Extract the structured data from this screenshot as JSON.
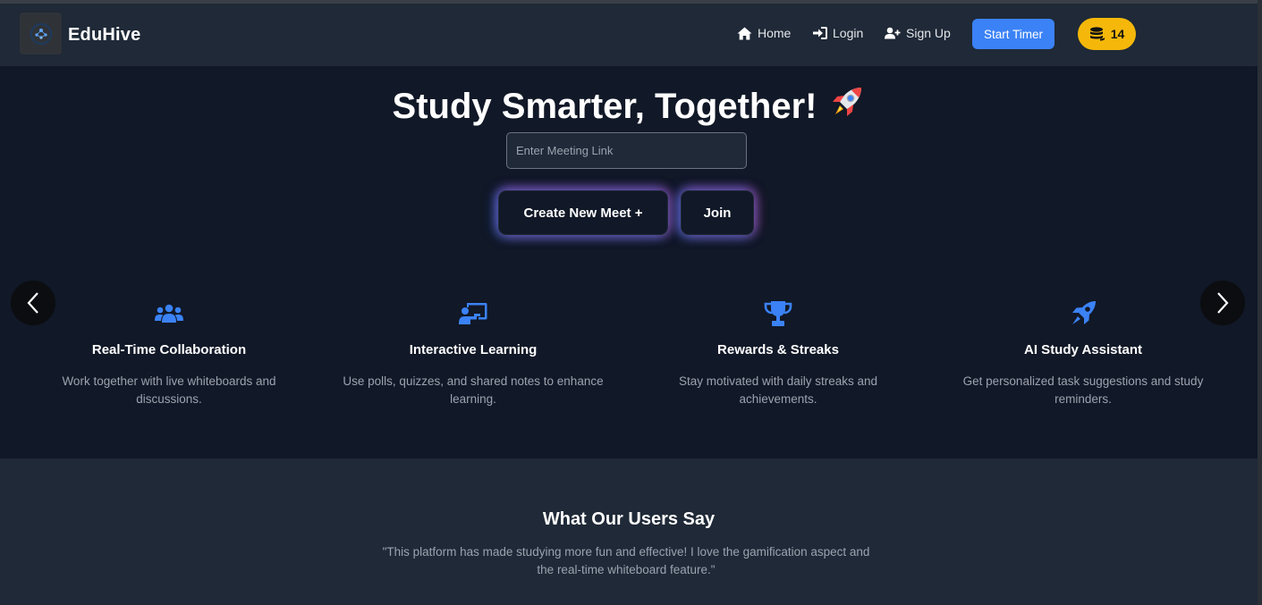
{
  "app": {
    "name": "EduHive"
  },
  "nav": {
    "home": "Home",
    "login": "Login",
    "signup": "Sign Up",
    "start_timer": "Start Timer",
    "coins": "14"
  },
  "hero": {
    "title": "Study Smarter, Together!",
    "meeting_placeholder": "Enter Meeting Link",
    "create_button": "Create New Meet +",
    "join_button": "Join"
  },
  "features": [
    {
      "icon": "users-icon",
      "title": "Real-Time Collaboration",
      "description": "Work together with live whiteboards and discussions."
    },
    {
      "icon": "chalkboard-teacher-icon",
      "title": "Interactive Learning",
      "description": "Use polls, quizzes, and shared notes to enhance learning."
    },
    {
      "icon": "trophy-icon",
      "title": "Rewards & Streaks",
      "description": "Stay motivated with daily streaks and achievements."
    },
    {
      "icon": "rocket-icon",
      "title": "AI Study Assistant",
      "description": "Get personalized task suggestions and study reminders."
    }
  ],
  "testimonials": {
    "title": "What Our Users Say",
    "quote": "\"This platform has made studying more fun and effective! I love the gamification aspect and the real-time whiteboard feature.\""
  },
  "colors": {
    "accent": "#3b82f6",
    "coin": "#f5b80a",
    "background": "#111827",
    "header": "#1f2937"
  }
}
